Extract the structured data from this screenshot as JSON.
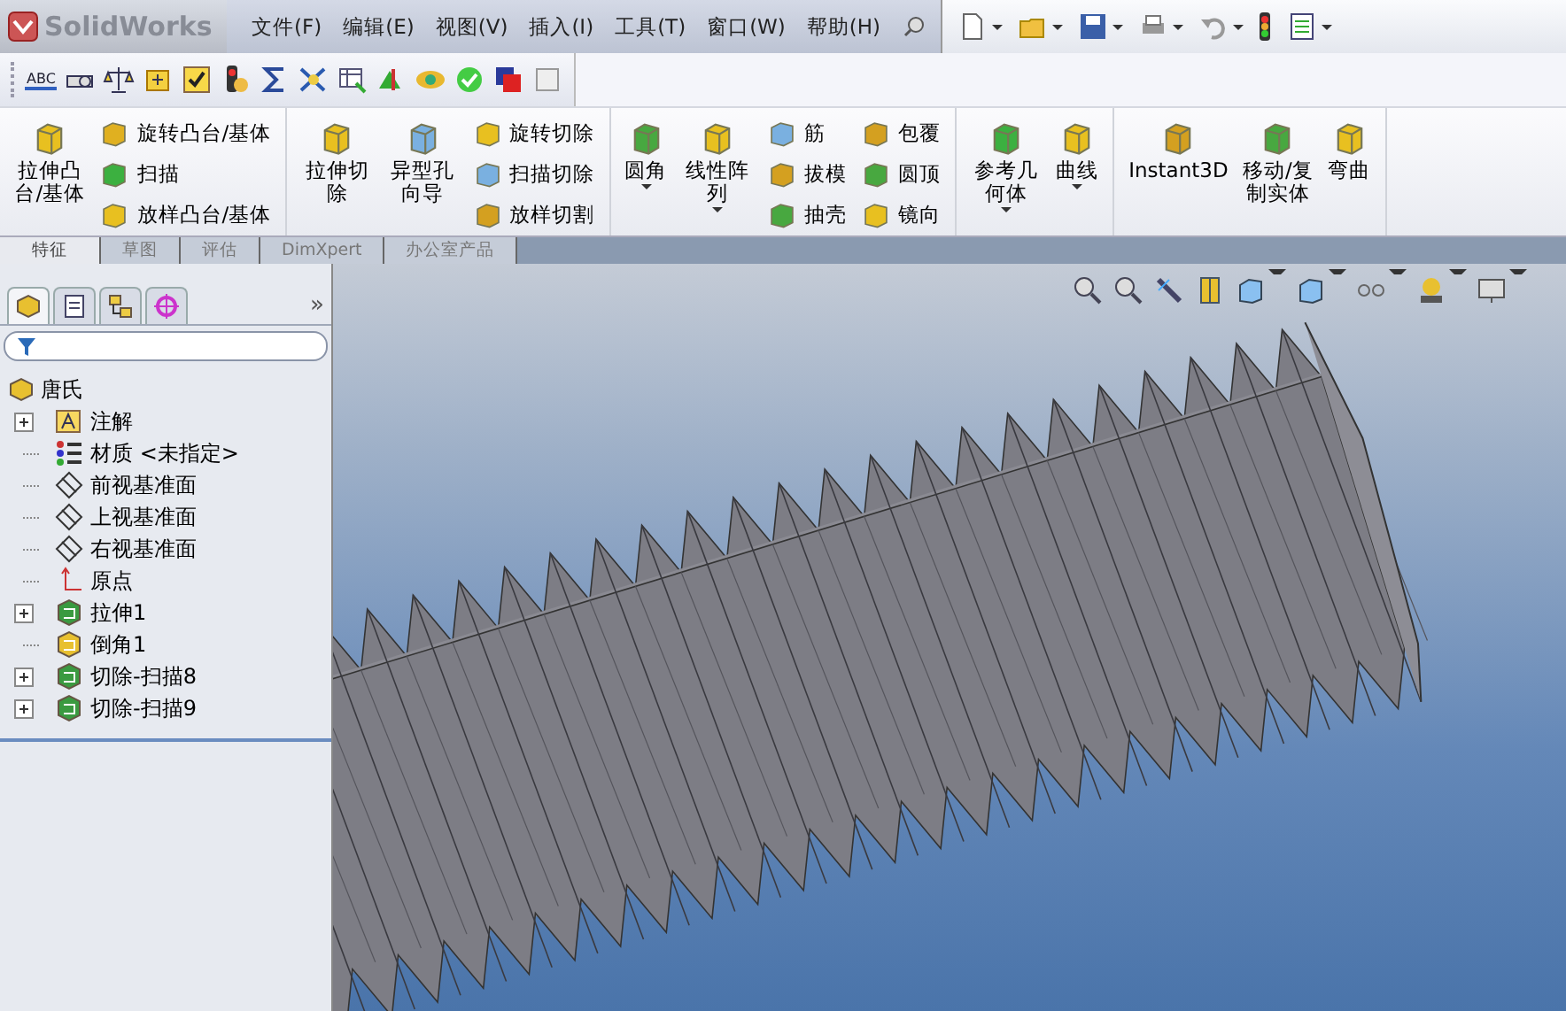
{
  "app_name": "SolidWorks",
  "menu": [
    "文件(F)",
    "编辑(E)",
    "视图(V)",
    "插入(I)",
    "工具(T)",
    "窗口(W)",
    "帮助(H)"
  ],
  "standard_toolbar": [
    {
      "dropdown": true
    },
    {
      "dropdown": true
    },
    {
      "dropdown": true
    },
    {
      "dropdown": true
    },
    {
      "dropdown": true
    },
    {
      "dropdown": false
    },
    {
      "dropdown": true
    }
  ],
  "spell_check_label": "ABC",
  "ribbon": [
    {
      "columns": [
        {
          "kind": "large",
          "label": "拉伸凸台/基体",
          "dropdown": false
        },
        {
          "kind": "stack",
          "items": [
            "旋转凸台/基体",
            "扫描",
            "放样凸台/基体"
          ]
        }
      ]
    },
    {
      "columns": [
        {
          "kind": "large",
          "label": "拉伸切除",
          "dropdown": false
        },
        {
          "kind": "large",
          "label": "异型孔向导",
          "dropdown": false
        },
        {
          "kind": "stack",
          "items": [
            "旋转切除",
            "扫描切除",
            "放样切割"
          ]
        }
      ]
    },
    {
      "columns": [
        {
          "kind": "large",
          "label": "圆角",
          "dropdown": true
        },
        {
          "kind": "large",
          "label": "线性阵列",
          "dropdown": true
        },
        {
          "kind": "stack",
          "items": [
            "筋",
            "拔模",
            "抽壳"
          ]
        },
        {
          "kind": "stack",
          "items": [
            "包覆",
            "圆顶",
            "镜向"
          ]
        }
      ]
    },
    {
      "columns": [
        {
          "kind": "large",
          "label": "参考几何体",
          "dropdown": true
        },
        {
          "kind": "large",
          "label": "曲线",
          "dropdown": true
        }
      ]
    },
    {
      "columns": [
        {
          "kind": "large",
          "label": "Instant3D",
          "dropdown": false
        },
        {
          "kind": "large",
          "label": "移动/复制实体",
          "dropdown": false
        },
        {
          "kind": "large",
          "label": "弯曲",
          "dropdown": false
        }
      ]
    }
  ],
  "tabs": [
    {
      "label": "特征",
      "selected": true
    },
    {
      "label": "草图",
      "selected": false
    },
    {
      "label": "评估",
      "selected": false
    },
    {
      "label": "DimXpert",
      "selected": false
    },
    {
      "label": "办公室产品",
      "selected": false
    }
  ],
  "panel_more": "»",
  "tree": {
    "label": "唐氏",
    "children": [
      {
        "label": "注解",
        "expandable": true
      },
      {
        "label": "材质 <未指定>",
        "expandable": false
      },
      {
        "label": "前视基准面",
        "expandable": false
      },
      {
        "label": "上视基准面",
        "expandable": false
      },
      {
        "label": "右视基准面",
        "expandable": false
      },
      {
        "label": "原点",
        "expandable": false
      },
      {
        "label": "拉伸1",
        "expandable": true
      },
      {
        "label": "倒角1",
        "expandable": false
      },
      {
        "label": "切除-扫描8",
        "expandable": true
      },
      {
        "label": "切除-扫描9",
        "expandable": true
      }
    ]
  }
}
